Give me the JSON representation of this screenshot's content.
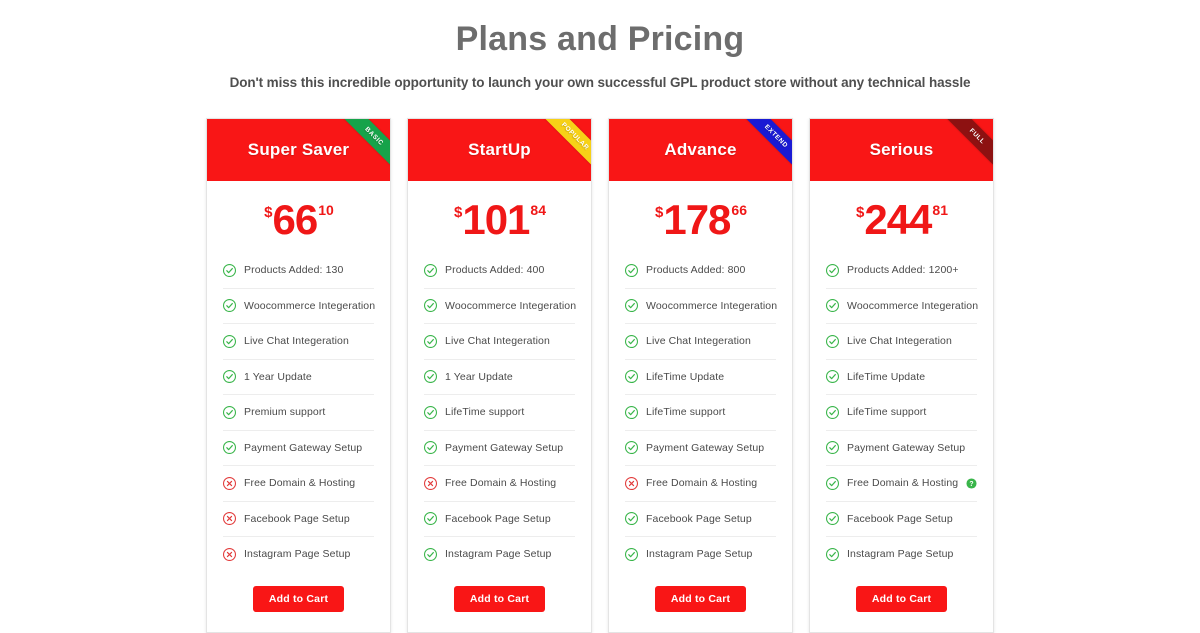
{
  "header": {
    "title": "Plans and Pricing",
    "subtitle": "Don't miss this incredible opportunity to launch your own successful GPL product store without any technical hassle"
  },
  "colors": {
    "brand_red": "#f91616",
    "price_red": "#f01717",
    "title_gray": "#6d6d6d",
    "check_green": "#39b54a",
    "cross_red": "#e23b3b",
    "ribbon_basic": "#16a34a",
    "ribbon_popular": "#f7d117",
    "ribbon_extend": "#1a1ad4",
    "ribbon_full": "#8d1111"
  },
  "cta_label": "Add to Cart",
  "plans": [
    {
      "name": "Super Saver",
      "ribbon": "BASIC",
      "ribbon_color": "#16a34a",
      "ribbon_text_color": "#ffffff",
      "currency": "$",
      "amount": "66",
      "cents": "10",
      "features": [
        {
          "label": "Products Added: 130",
          "status": "check",
          "help": false
        },
        {
          "label": "Woocommerce Integeration",
          "status": "check",
          "help": false
        },
        {
          "label": "Live Chat Integeration",
          "status": "check",
          "help": false
        },
        {
          "label": "1 Year Update",
          "status": "check",
          "help": false
        },
        {
          "label": "Premium support",
          "status": "check",
          "help": false
        },
        {
          "label": "Payment Gateway Setup",
          "status": "check",
          "help": false
        },
        {
          "label": "Free Domain & Hosting",
          "status": "cross",
          "help": false
        },
        {
          "label": "Facebook Page Setup",
          "status": "cross",
          "help": false
        },
        {
          "label": "Instagram Page Setup",
          "status": "cross",
          "help": false
        }
      ]
    },
    {
      "name": "StartUp",
      "ribbon": "POPULAR",
      "ribbon_color": "#f7d117",
      "ribbon_text_color": "#ffffff",
      "currency": "$",
      "amount": "101",
      "cents": "84",
      "features": [
        {
          "label": "Products Added: 400",
          "status": "check",
          "help": false
        },
        {
          "label": "Woocommerce Integeration",
          "status": "check",
          "help": false
        },
        {
          "label": "Live Chat Integeration",
          "status": "check",
          "help": false
        },
        {
          "label": "1 Year Update",
          "status": "check",
          "help": false
        },
        {
          "label": "LifeTime support",
          "status": "check",
          "help": false
        },
        {
          "label": "Payment Gateway Setup",
          "status": "check",
          "help": false
        },
        {
          "label": "Free Domain & Hosting",
          "status": "cross",
          "help": false
        },
        {
          "label": "Facebook Page Setup",
          "status": "check",
          "help": false
        },
        {
          "label": "Instagram Page Setup",
          "status": "check",
          "help": false
        }
      ]
    },
    {
      "name": "Advance",
      "ribbon": "EXTEND",
      "ribbon_color": "#1a1ad4",
      "ribbon_text_color": "#ffffff",
      "currency": "$",
      "amount": "178",
      "cents": "66",
      "features": [
        {
          "label": "Products Added: 800",
          "status": "check",
          "help": false
        },
        {
          "label": "Woocommerce Integeration",
          "status": "check",
          "help": false
        },
        {
          "label": "Live Chat Integeration",
          "status": "check",
          "help": false
        },
        {
          "label": "LifeTime Update",
          "status": "check",
          "help": false
        },
        {
          "label": "LifeTime support",
          "status": "check",
          "help": false
        },
        {
          "label": "Payment Gateway Setup",
          "status": "check",
          "help": false
        },
        {
          "label": "Free Domain & Hosting",
          "status": "cross",
          "help": false
        },
        {
          "label": "Facebook Page Setup",
          "status": "check",
          "help": false
        },
        {
          "label": "Instagram Page Setup",
          "status": "check",
          "help": false
        }
      ]
    },
    {
      "name": "Serious",
      "ribbon": "FULL",
      "ribbon_color": "#8d1111",
      "ribbon_text_color": "#ffffff",
      "currency": "$",
      "amount": "244",
      "cents": "81",
      "features": [
        {
          "label": "Products Added: 1200+",
          "status": "check",
          "help": false
        },
        {
          "label": "Woocommerce Integeration",
          "status": "check",
          "help": false
        },
        {
          "label": "Live Chat Integeration",
          "status": "check",
          "help": false
        },
        {
          "label": "LifeTime Update",
          "status": "check",
          "help": false
        },
        {
          "label": "LifeTime support",
          "status": "check",
          "help": false
        },
        {
          "label": "Payment Gateway Setup",
          "status": "check",
          "help": false
        },
        {
          "label": "Free Domain & Hosting",
          "status": "check",
          "help": true
        },
        {
          "label": "Facebook Page Setup",
          "status": "check",
          "help": false
        },
        {
          "label": "Instagram Page Setup",
          "status": "check",
          "help": false
        }
      ]
    }
  ]
}
